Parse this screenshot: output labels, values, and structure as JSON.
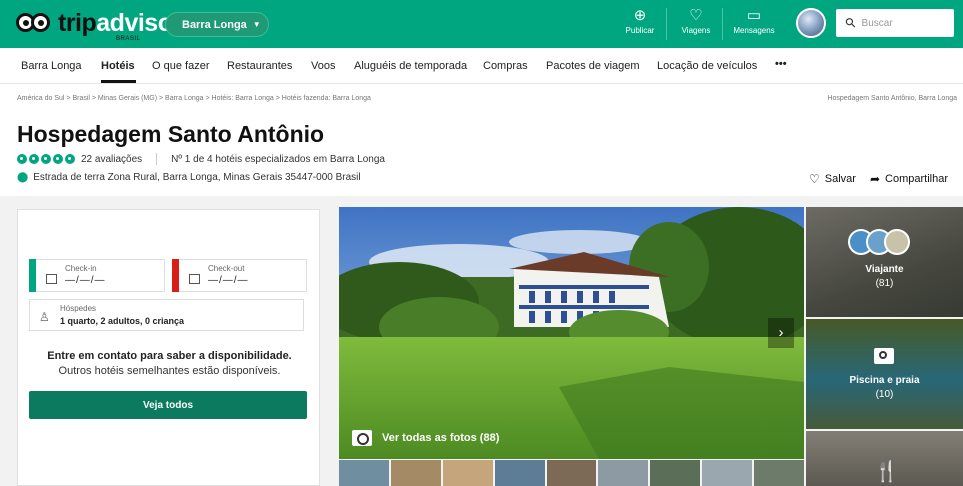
{
  "header": {
    "logo_trip": "trip",
    "logo_advisor": "advisor",
    "logo_sub": "BRASIL",
    "location": "Barra Longa",
    "publish": "Publicar",
    "trips": "Viagens",
    "messages": "Mensagens",
    "search_placeholder": "Buscar",
    "brand_color": "#00a680"
  },
  "subnav": {
    "items": [
      "Barra Longa",
      "Hotéis",
      "O que fazer",
      "Restaurantes",
      "Voos",
      "Aluguéis de temporada",
      "Compras",
      "Pacotes de viagem",
      "Locação de veículos",
      "•••"
    ],
    "active": "Hotéis"
  },
  "breadcrumb": "América do Sul  >  Brasil  >  Minas Gerais (MG)  >  Barra Longa  >  Hotéis: Barra Longa  >  Hotéis fazenda: Barra Longa",
  "breadcrumb_right": "Hospedagem Santo Antônio, Barra Longa",
  "hotel": {
    "name": "Hospedagem Santo Antônio",
    "rating_bubbles": 5,
    "reviews": "22 avaliações",
    "rank": "Nº 1 de 4 hotéis especializados em Barra Longa",
    "address": "Estrada de terra Zona Rural, Barra Longa, Minas Gerais 35447-000 Brasil",
    "save": "Salvar",
    "share": "Compartilhar"
  },
  "booking": {
    "checkin_label": "Check-in",
    "checkin_value": "—/—/—",
    "checkout_label": "Check-out",
    "checkout_value": "—/—/—",
    "guests_label": "Hóspedes",
    "guests_value": "1 quarto, 2 adultos, 0 criança",
    "availability_title": "Entre em contato para saber a disponibilidade.",
    "availability_sub": "Outros hotéis semelhantes estão disponíveis.",
    "see_all": "Veja todos",
    "checkin_color": "#00a680",
    "checkout_color": "#d91e18"
  },
  "photos": {
    "see_all": "Ver todas as fotos (88)",
    "side": [
      {
        "label": "Viajante",
        "count": "(81)"
      },
      {
        "label": "Piscina e praia",
        "count": "(10)"
      }
    ]
  }
}
